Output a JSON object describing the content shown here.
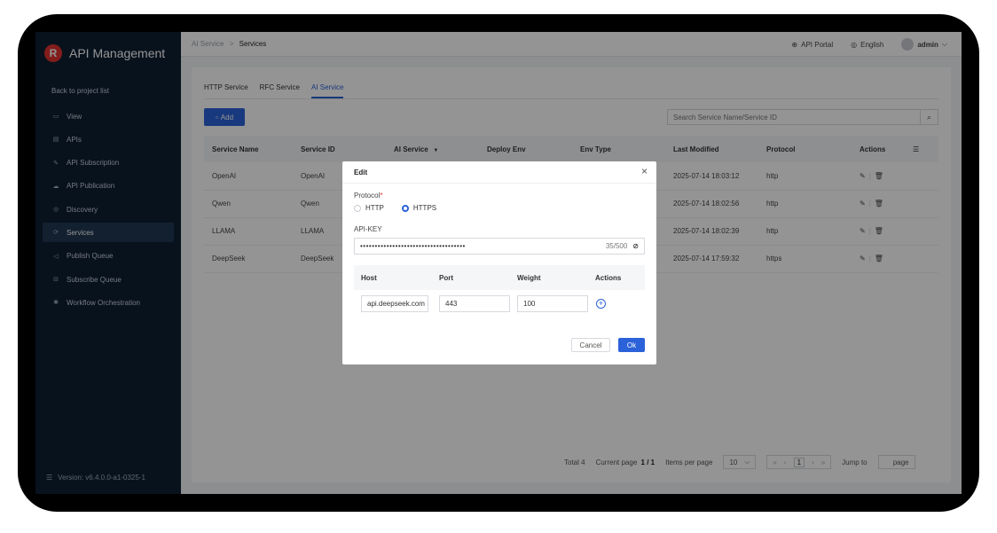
{
  "sidebar": {
    "brand_title": "API Management",
    "logo_letter": "R",
    "back_label": "Back to project list",
    "items": [
      {
        "label": "View",
        "icon": "view-icon",
        "glyph": "▭"
      },
      {
        "label": "APIs",
        "icon": "apis-icon",
        "glyph": "▤"
      },
      {
        "label": "API Subscription",
        "icon": "subscription-icon",
        "glyph": "✎"
      },
      {
        "label": "API Publication",
        "icon": "publication-icon",
        "glyph": "☁"
      },
      {
        "label": "Discovery",
        "icon": "discovery-icon",
        "glyph": "◎"
      },
      {
        "label": "Services",
        "icon": "services-icon",
        "glyph": "⟳"
      },
      {
        "label": "Publish Queue",
        "icon": "publish-queue-icon",
        "glyph": "◁"
      },
      {
        "label": "Subscribe Queue",
        "icon": "subscribe-queue-icon",
        "glyph": "⊟"
      },
      {
        "label": "Workflow Orchestration",
        "icon": "workflow-icon",
        "glyph": "✱"
      }
    ],
    "active_index": 5,
    "version": "Version: v6.4.0.0-a1-0325-1"
  },
  "header": {
    "breadcrumb_parent": "AI Service",
    "breadcrumb_sep": ">",
    "breadcrumb_current": "Services",
    "api_portal": "API Portal",
    "language": "English",
    "user": "admin"
  },
  "tabs": [
    "HTTP Service",
    "RFC Service",
    "AI Service"
  ],
  "active_tab": 2,
  "toolbar": {
    "add_label": "Add",
    "search_placeholder": "Search Service Name/Service ID"
  },
  "table": {
    "columns": [
      "Service Name",
      "Service ID",
      "AI Service",
      "Deploy Env",
      "Env Type",
      "Last Modified",
      "Protocol",
      "Actions"
    ],
    "rows": [
      {
        "name": "OpenAI",
        "id": "OpenAI",
        "modified": "2025-07-14 18:03:12",
        "protocol": "http"
      },
      {
        "name": "Qwen",
        "id": "Qwen",
        "modified": "2025-07-14 18:02:56",
        "protocol": "http"
      },
      {
        "name": "LLAMA",
        "id": "LLAMA",
        "modified": "2025-07-14 18:02:39",
        "protocol": "http"
      },
      {
        "name": "DeepSeek",
        "id": "DeepSeek",
        "modified": "2025-07-14 17:59:32",
        "protocol": "https"
      }
    ]
  },
  "pagination": {
    "total": "Total 4",
    "current_label": "Current page",
    "current": "1 / 1",
    "items_label": "Items per page",
    "page_size": "10",
    "page_number": "1",
    "jump_label": "Jump to",
    "page_suffix": "page"
  },
  "modal": {
    "title": "Edit",
    "protocol_label": "Protocol",
    "protocol_options": [
      "HTTP",
      "HTTPS"
    ],
    "protocol_selected": 1,
    "apikey_label": "API-KEY",
    "apikey_value": "••••••••••••••••••••••••••••••••••••",
    "apikey_count": "35/500",
    "host_columns": [
      "Host",
      "Port",
      "Weight",
      "Actions"
    ],
    "host_row": {
      "host": "api.deepseek.com",
      "port": "443",
      "weight": "100"
    },
    "cancel_label": "Cancel",
    "ok_label": "Ok"
  },
  "colors": {
    "accent": "#2b62d9",
    "sidebar_bg": "#0f1f33",
    "brand_red": "#e0332f"
  }
}
